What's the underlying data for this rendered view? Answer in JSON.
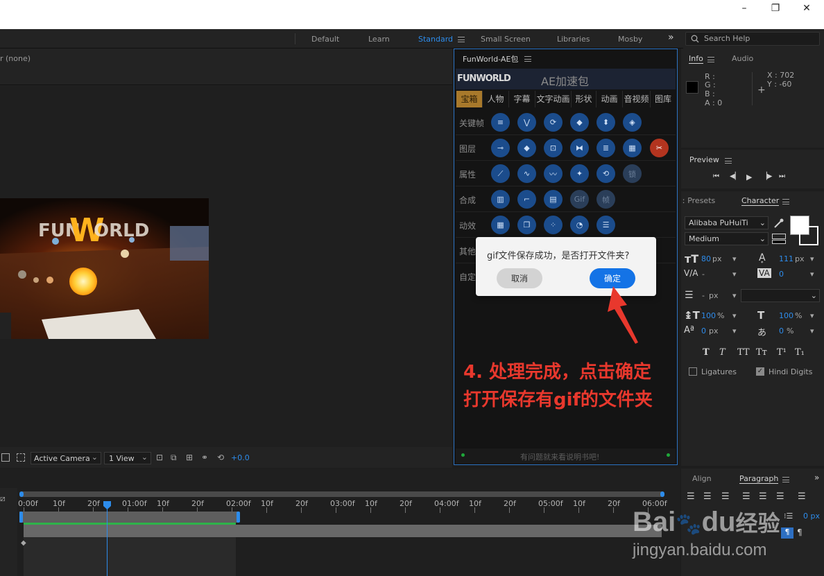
{
  "window_controls": {
    "minimize": "–",
    "maximize": "❐",
    "close": "✕"
  },
  "workspaces": [
    {
      "label": "Default",
      "active": false
    },
    {
      "label": "Learn",
      "active": false
    },
    {
      "label": "Standard",
      "active": true
    },
    {
      "label": "Small Screen",
      "active": false
    },
    {
      "label": "Libraries",
      "active": false
    },
    {
      "label": "Mosby",
      "active": false
    }
  ],
  "more_workspaces": "»",
  "search_placeholder": "Search Help",
  "comp_panel": {
    "layer_label": "r  (none)",
    "camera": "Active Camera",
    "views": "1 View",
    "exposure": "+0.0"
  },
  "plugin": {
    "title": "FunWorld-AE包",
    "logo_text": "FUNWORLD",
    "banner": "AE加速包",
    "tabs": [
      "宝箱",
      "人物",
      "字幕",
      "文字动画",
      "形状",
      "动画",
      "音视频",
      "图库"
    ],
    "categories": [
      "关键帧",
      "图层",
      "属性",
      "合成",
      "动效",
      "其他",
      "自定"
    ],
    "btn_gif": "Gif",
    "btn_frame": "帧",
    "btn_lock": "锁",
    "footer": "有问题就来看说明书吧!"
  },
  "dialog": {
    "message": "gif文件保存成功，是否打开文件夹?",
    "cancel": "取消",
    "ok": "确定"
  },
  "annotation": {
    "line1": "4. 处理完成，点击确定",
    "line2": "打开保存有gif的文件夹"
  },
  "info_panel": {
    "tab_info": "Info",
    "tab_audio": "Audio",
    "r": "R :",
    "g": "G :",
    "b": "B :",
    "a": "A : 0",
    "x": "X : 702",
    "y": "Y : -60"
  },
  "preview_panel": {
    "title": "Preview"
  },
  "character_panel": {
    "tab_presets": "Presets",
    "tab_character": "Character",
    "font": "Alibaba PuHuiTi",
    "style": "Medium",
    "size": "80",
    "size_unit": "px",
    "leading": "111",
    "leading_unit": "px",
    "kerning": "-",
    "tracking": "0",
    "stroke_width": "-",
    "stroke_unit": "px",
    "vscale": "100",
    "vscale_unit": "%",
    "hscale": "100",
    "hscale_unit": "%",
    "baseline": "0",
    "baseline_unit": "px",
    "tsume": "0",
    "tsume_unit": "%",
    "ligatures": "Ligatures",
    "hindi_digits": "Hindi Digits"
  },
  "paragraph_panel": {
    "tab_align": "Align",
    "tab_paragraph": "Paragraph",
    "value_px": "0 px"
  },
  "timeline": {
    "ticks": [
      "0:00f",
      "10f",
      "20f",
      "01:00f",
      "10f",
      "20f",
      "02:00f",
      "10f",
      "20f",
      "03:00f",
      "10f",
      "20f",
      "04:00f",
      "10f",
      "20f",
      "05:00f",
      "10f",
      "20f",
      "06:00f"
    ]
  },
  "watermark": {
    "brand": "Bai",
    "brand2": "du",
    "site": "经验",
    "url": "jingyan.baidu.com"
  }
}
